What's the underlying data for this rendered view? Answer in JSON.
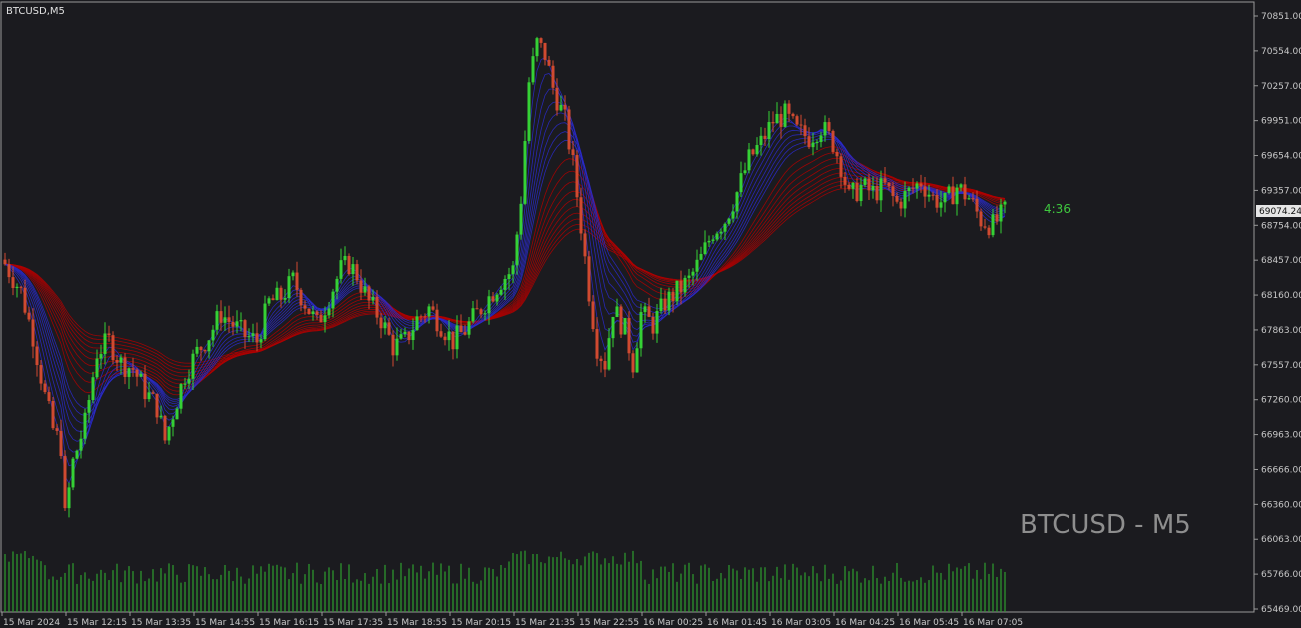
{
  "header": {
    "symbol": "BTCUSD,M5"
  },
  "watermark": "BTCUSD - M5",
  "timer": "4:36",
  "current_price": "69074.24",
  "colors": {
    "background": "#1b1b1f",
    "bull": "#35d135",
    "bear": "#d04a30",
    "ribbon_red": "#b00000",
    "ribbon_blue": "#2a2acb",
    "volume": "#2f9e2f",
    "axis": "#c8c8c8"
  },
  "chart_data": {
    "type": "candlestick",
    "y_ticks": [
      "70851.00",
      "70554.00",
      "70257.00",
      "69951.00",
      "69654.00",
      "69357.00",
      "68754.00",
      "68457.00",
      "68160.00",
      "67863.00",
      "67557.00",
      "67260.00",
      "66963.00",
      "66666.00",
      "66360.00",
      "66063.00",
      "65766.00",
      "65469.00"
    ],
    "x_ticks": [
      "15 Mar 2024",
      "15 Mar 12:15",
      "15 Mar 13:35",
      "15 Mar 14:55",
      "15 Mar 16:15",
      "15 Mar 17:35",
      "15 Mar 18:55",
      "15 Mar 20:15",
      "15 Mar 21:35",
      "15 Mar 22:55",
      "16 Mar 00:25",
      "16 Mar 01:45",
      "16 Mar 03:05",
      "16 Mar 04:25",
      "16 Mar 05:45",
      "16 Mar 07:05"
    ],
    "ylim": [
      65469,
      70851
    ],
    "close_path": [
      [
        0,
        68600
      ],
      [
        4,
        68350
      ],
      [
        7,
        67950
      ],
      [
        10,
        67400
      ],
      [
        12,
        67100
      ],
      [
        14,
        66950
      ],
      [
        15,
        66300
      ],
      [
        17,
        66800
      ],
      [
        20,
        67150
      ],
      [
        23,
        67800
      ],
      [
        26,
        67900
      ],
      [
        29,
        67700
      ],
      [
        32,
        67650
      ],
      [
        35,
        67450
      ],
      [
        38,
        67300
      ],
      [
        40,
        67000
      ],
      [
        42,
        67250
      ],
      [
        45,
        67600
      ],
      [
        48,
        67800
      ],
      [
        51,
        67950
      ],
      [
        54,
        68150
      ],
      [
        57,
        68050
      ],
      [
        60,
        67950
      ],
      [
        63,
        67900
      ],
      [
        66,
        68250
      ],
      [
        69,
        68300
      ],
      [
        72,
        68450
      ],
      [
        75,
        68250
      ],
      [
        78,
        68050
      ],
      [
        81,
        68300
      ],
      [
        84,
        68550
      ],
      [
        86,
        68600
      ],
      [
        88,
        68500
      ],
      [
        91,
        68250
      ],
      [
        94,
        68100
      ],
      [
        97,
        67850
      ],
      [
        100,
        67900
      ],
      [
        103,
        68100
      ],
      [
        106,
        68200
      ],
      [
        109,
        68050
      ],
      [
        112,
        67900
      ],
      [
        115,
        68000
      ],
      [
        118,
        68150
      ],
      [
        121,
        68300
      ],
      [
        124,
        68450
      ],
      [
        127,
        68550
      ],
      [
        129,
        69200
      ],
      [
        131,
        70250
      ],
      [
        133,
        70600
      ],
      [
        135,
        70500
      ],
      [
        137,
        70200
      ],
      [
        140,
        69900
      ],
      [
        142,
        69500
      ],
      [
        144,
        68950
      ],
      [
        146,
        68350
      ],
      [
        148,
        67850
      ],
      [
        150,
        67700
      ],
      [
        152,
        68200
      ],
      [
        155,
        68000
      ],
      [
        157,
        67700
      ],
      [
        159,
        68150
      ],
      [
        162,
        68050
      ],
      [
        165,
        68250
      ],
      [
        168,
        68350
      ],
      [
        171,
        68450
      ],
      [
        174,
        68650
      ],
      [
        177,
        68900
      ],
      [
        180,
        69000
      ],
      [
        183,
        69250
      ],
      [
        186,
        69550
      ],
      [
        189,
        69700
      ],
      [
        192,
        69900
      ],
      [
        195,
        69950
      ],
      [
        198,
        69800
      ],
      [
        201,
        69750
      ],
      [
        204,
        69850
      ],
      [
        207,
        69700
      ],
      [
        209,
        69500
      ],
      [
        211,
        69200
      ],
      [
        214,
        69300
      ],
      [
        217,
        69250
      ],
      [
        220,
        69300
      ],
      [
        223,
        69150
      ],
      [
        226,
        69250
      ],
      [
        229,
        69350
      ],
      [
        232,
        69200
      ],
      [
        235,
        69150
      ],
      [
        238,
        69300
      ],
      [
        241,
        69200
      ],
      [
        244,
        69000
      ],
      [
        247,
        68950
      ],
      [
        250,
        69074
      ]
    ],
    "volume_range": [
      0,
      1
    ]
  }
}
